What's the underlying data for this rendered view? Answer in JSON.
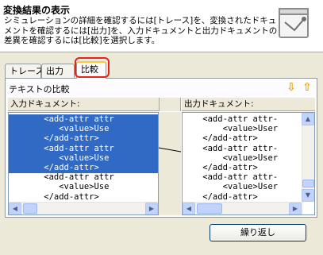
{
  "header": {
    "title": "変換結果の表示",
    "description": "シミュレーションの詳細を確認するには[トレース]を、変換されたドキュメントを確認するには[出力]を、入力ドキュメントと出力ドキュメントの差異を確認するには[比較]を選択します。",
    "icon": "document-window-icon"
  },
  "tabs": [
    {
      "label": "トレース"
    },
    {
      "label": "出力"
    },
    {
      "label": "比較",
      "active": true
    }
  ],
  "compare": {
    "title": "テキストの比較",
    "next_diff_icon": "arrow-down-icon",
    "prev_diff_icon": "arrow-up-icon",
    "left": {
      "header": "入力ドキュメント:",
      "lines": [
        {
          "text": "       <add-attr attr",
          "selected": true
        },
        {
          "text": "          <value>Use",
          "selected": true
        },
        {
          "text": "       </add-attr>",
          "selected": true
        },
        {
          "text": "       <add-attr attr",
          "selected": true
        },
        {
          "text": "          <value>Use",
          "selected": true
        },
        {
          "text": "       </add-attr>",
          "selected": true
        },
        {
          "text": "       <add-attr attr",
          "selected": false
        },
        {
          "text": "          <value>Use",
          "selected": false
        },
        {
          "text": "       </add-attr>",
          "selected": false
        }
      ]
    },
    "right": {
      "header": "出力ドキュメント:",
      "lines": [
        "    <add-attr attr-",
        "        <value>User",
        "    </add-attr>",
        "    <add-attr attr-",
        "        <value>User",
        "    </add-attr>",
        "    <add-attr attr-",
        "        <value>User",
        "    </add-attr>"
      ]
    }
  },
  "buttons": {
    "revert": "繰り返し"
  }
}
